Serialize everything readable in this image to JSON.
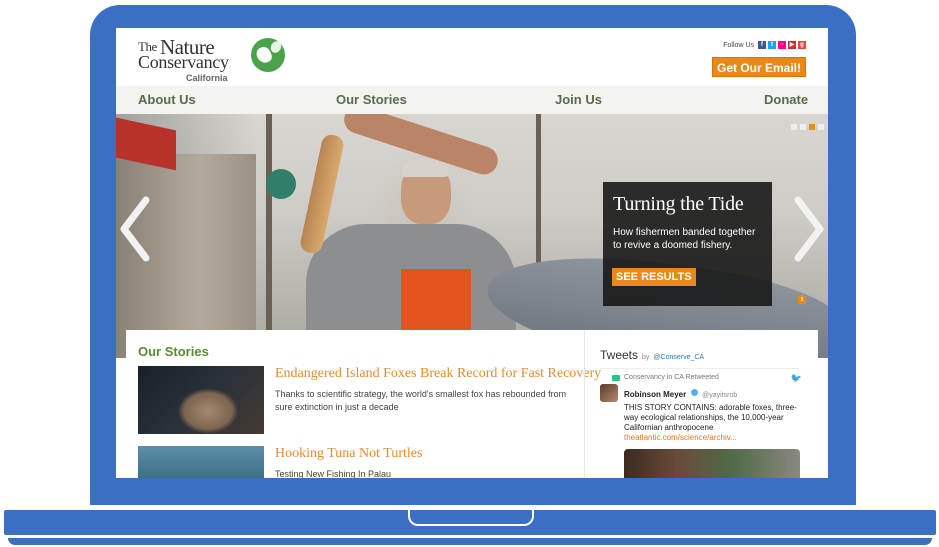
{
  "header": {
    "logo": {
      "the": "The",
      "nature": "Nature",
      "conservancy": "Conservancy",
      "region": "California"
    },
    "follow_label": "Follow Us",
    "social_icons": [
      "facebook-icon",
      "twitter-icon",
      "flickr-icon",
      "youtube-icon",
      "google-plus-icon"
    ],
    "email_button": "Get Our Email!"
  },
  "nav": {
    "items": [
      {
        "label": "About Us"
      },
      {
        "label": "Our Stories"
      },
      {
        "label": "Join Us"
      },
      {
        "label": "Donate"
      }
    ]
  },
  "hero": {
    "title": "Turning the Tide",
    "text": "How fishermen banded together to revive a doomed fishery.",
    "button": "SEE RESULTS",
    "slides_total": 4,
    "active_slide": 3,
    "info_icon": "i"
  },
  "stories": {
    "title": "Our Stories",
    "items": [
      {
        "headline": "Endangered Island Foxes Break Record for Fast Recovery",
        "summary": "Thanks to scientific strategy, the world's smallest fox has rebounded from sure extinction in just a decade"
      },
      {
        "headline": "Hooking Tuna Not Turtles",
        "summary": "Testing New Fishing In Palau"
      }
    ]
  },
  "tweets": {
    "title": "Tweets",
    "by": "by",
    "handle": "@Conserve_CA",
    "retweet_label": "Conservancy in CA Retweeted",
    "tweet": {
      "author": "Robinson Meyer",
      "author_handle": "@yayitsrob",
      "text": "THIS STORY CONTAINS: adorable foxes, three-way ecological relationships, the 10,000-year Californian anthropocene",
      "link": "theatlantic.com/science/archiv..."
    }
  },
  "colors": {
    "frame": "#3a6fc3",
    "accent_orange": "#e88a1a",
    "nav_text": "#5a6a4c",
    "stories_green": "#5b8a2f"
  }
}
